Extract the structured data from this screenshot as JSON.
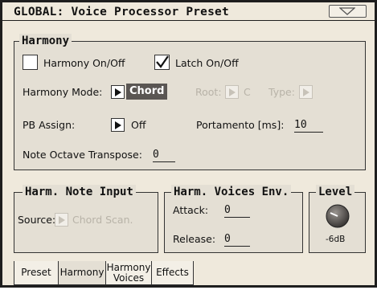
{
  "window": {
    "title": "GLOBAL: Voice Processor Preset",
    "menu_icon": "triangle-down-icon"
  },
  "harmony_panel": {
    "header": "Harmony",
    "harmony_onoff": {
      "label": "Harmony On/Off",
      "checked": false
    },
    "latch_onoff": {
      "label": "Latch On/Off",
      "checked": true
    },
    "harmony_mode": {
      "label": "Harmony Mode:",
      "value": "Chord"
    },
    "root": {
      "label": "Root:",
      "value": "C"
    },
    "type": {
      "label": "Type:"
    },
    "pb_assign": {
      "label": "PB Assign:",
      "value": "Off"
    },
    "portamento": {
      "label": "Portamento [ms]:",
      "value": "10"
    },
    "note_octave_transpose": {
      "label": "Note Octave Transpose:",
      "value": "0"
    }
  },
  "note_input_panel": {
    "header": "Harm. Note Input",
    "source": {
      "label": "Source:",
      "value": "Chord Scan."
    }
  },
  "voices_env_panel": {
    "header": "Harm. Voices Env.",
    "attack": {
      "label": "Attack:",
      "value": "0"
    },
    "release": {
      "label": "Release:",
      "value": "0"
    }
  },
  "level_panel": {
    "header": "Level",
    "value": "-6dB"
  },
  "tabs": [
    {
      "label": "Preset",
      "active": false
    },
    {
      "label": "Harmony",
      "active": true
    },
    {
      "label_line1": "Harmony",
      "label_line2": "Voices",
      "active": false
    },
    {
      "label": "Effects",
      "active": false
    }
  ],
  "colors": {
    "background": "#efe9dc",
    "panel": "#e4dfd4",
    "selected": "#5a5653",
    "disabled_text": "#b8b3a8"
  }
}
